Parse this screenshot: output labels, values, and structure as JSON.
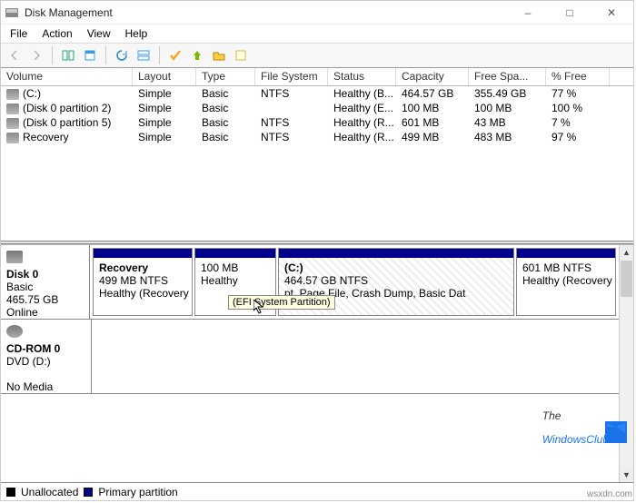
{
  "window": {
    "title": "Disk Management"
  },
  "menu": {
    "file": "File",
    "action": "Action",
    "view": "View",
    "help": "Help"
  },
  "columns": {
    "volume": "Volume",
    "layout": "Layout",
    "type": "Type",
    "fs": "File System",
    "status": "Status",
    "capacity": "Capacity",
    "free": "Free Spa...",
    "pct": "% Free"
  },
  "volumes": [
    {
      "name": "(C:)",
      "layout": "Simple",
      "type": "Basic",
      "fs": "NTFS",
      "status": "Healthy (B...",
      "cap": "464.57 GB",
      "free": "355.49 GB",
      "pct": "77 %"
    },
    {
      "name": "(Disk 0 partition 2)",
      "layout": "Simple",
      "type": "Basic",
      "fs": "",
      "status": "Healthy (E...",
      "cap": "100 MB",
      "free": "100 MB",
      "pct": "100 %"
    },
    {
      "name": "(Disk 0 partition 5)",
      "layout": "Simple",
      "type": "Basic",
      "fs": "NTFS",
      "status": "Healthy (R...",
      "cap": "601 MB",
      "free": "43 MB",
      "pct": "7 %"
    },
    {
      "name": "Recovery",
      "layout": "Simple",
      "type": "Basic",
      "fs": "NTFS",
      "status": "Healthy (R...",
      "cap": "499 MB",
      "free": "483 MB",
      "pct": "97 %"
    }
  ],
  "disk0": {
    "label": "Disk 0",
    "kind": "Basic",
    "size": "465.75 GB",
    "state": "Online",
    "parts": [
      {
        "name": "Recovery",
        "line2": "499 MB NTFS",
        "line3": "Healthy (Recovery Pa"
      },
      {
        "name": "",
        "line2": "100 MB",
        "line3": "Healthy"
      },
      {
        "name": "(C:)",
        "line2": "464.57 GB NTFS",
        "line3": "pt, Page File, Crash Dump, Basic Dat"
      },
      {
        "name": "",
        "line2": "601 MB NTFS",
        "line3": "Healthy (Recovery Par"
      }
    ]
  },
  "cdrom": {
    "label": "CD-ROM 0",
    "line2": "DVD (D:)",
    "line3": "No Media"
  },
  "tooltip": "(EFI System Partition)",
  "legend": {
    "unalloc": "Unallocated",
    "primary": "Primary partition"
  },
  "watermark": {
    "the": "The",
    "rest": "WindowsClub"
  },
  "footer": "wsxdn.com"
}
